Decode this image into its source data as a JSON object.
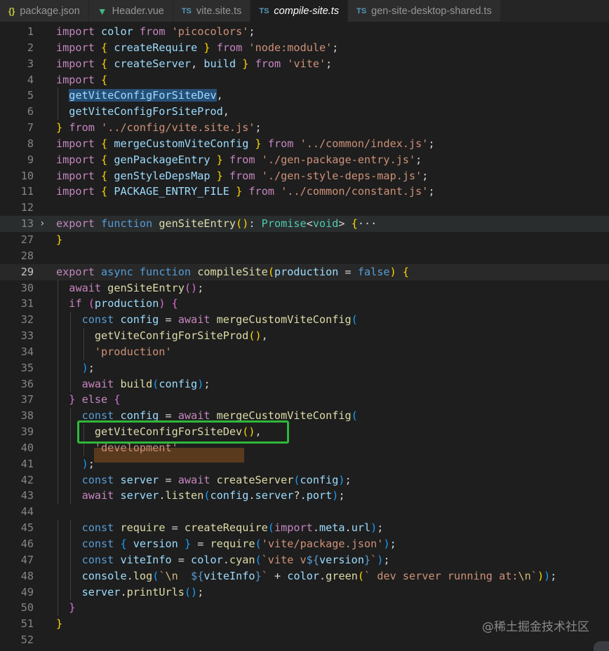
{
  "tabs": [
    {
      "label": "package.json",
      "icon": "{}",
      "icon_name": "json-icon",
      "icon_class": "json",
      "active": false
    },
    {
      "label": "Header.vue",
      "icon": "▼",
      "icon_name": "vue-icon",
      "icon_class": "vue",
      "active": false
    },
    {
      "label": "vite.site.ts",
      "icon": "TS",
      "icon_name": "typescript-icon",
      "icon_class": "ts",
      "active": false
    },
    {
      "label": "compile-site.ts",
      "icon": "TS",
      "icon_name": "typescript-icon",
      "icon_class": "ts",
      "active": true
    },
    {
      "label": "gen-site-desktop-shared.ts",
      "icon": "TS",
      "icon_name": "typescript-icon",
      "icon_class": "ts",
      "active": false
    }
  ],
  "colors": {
    "editor_bg": "#1e1e1e",
    "keyword": "#c586c0",
    "storage": "#569cd6",
    "string": "#ce9178",
    "function": "#dcdcaa",
    "variable": "#9cdcfe",
    "type": "#4ec9b0",
    "highlight_box": "#2fb83a"
  },
  "current_line": "29",
  "editor_lines": [
    {
      "n": "1",
      "tokens": [
        [
          "k",
          "import"
        ],
        [
          "p",
          " "
        ],
        [
          "v",
          "color"
        ],
        [
          "p",
          " "
        ],
        [
          "k",
          "from"
        ],
        [
          "p",
          " "
        ],
        [
          "s",
          "'picocolors'"
        ],
        [
          "p",
          ";"
        ]
      ]
    },
    {
      "n": "2",
      "tokens": [
        [
          "k",
          "import"
        ],
        [
          "p",
          " "
        ],
        [
          "b1",
          "{"
        ],
        [
          "p",
          " "
        ],
        [
          "v",
          "createRequire"
        ],
        [
          "p",
          " "
        ],
        [
          "b1",
          "}"
        ],
        [
          "p",
          " "
        ],
        [
          "k",
          "from"
        ],
        [
          "p",
          " "
        ],
        [
          "s",
          "'node:module'"
        ],
        [
          "p",
          ";"
        ]
      ]
    },
    {
      "n": "3",
      "tokens": [
        [
          "k",
          "import"
        ],
        [
          "p",
          " "
        ],
        [
          "b1",
          "{"
        ],
        [
          "p",
          " "
        ],
        [
          "v",
          "createServer"
        ],
        [
          "p",
          ", "
        ],
        [
          "v",
          "build"
        ],
        [
          "p",
          " "
        ],
        [
          "b1",
          "}"
        ],
        [
          "p",
          " "
        ],
        [
          "k",
          "from"
        ],
        [
          "p",
          " "
        ],
        [
          "s",
          "'vite'"
        ],
        [
          "p",
          ";"
        ]
      ]
    },
    {
      "n": "4",
      "tokens": [
        [
          "k",
          "import"
        ],
        [
          "p",
          " "
        ],
        [
          "b1",
          "{"
        ]
      ]
    },
    {
      "n": "5",
      "tokens": [
        [
          "p",
          "  "
        ],
        [
          "v sel",
          "getViteConfigForSiteDev"
        ],
        [
          "p",
          ","
        ]
      ]
    },
    {
      "n": "6",
      "tokens": [
        [
          "p",
          "  "
        ],
        [
          "v",
          "getViteConfigForSiteProd"
        ],
        [
          "p",
          ","
        ]
      ]
    },
    {
      "n": "7",
      "tokens": [
        [
          "b1",
          "}"
        ],
        [
          "p",
          " "
        ],
        [
          "k",
          "from"
        ],
        [
          "p",
          " "
        ],
        [
          "s",
          "'../config/vite.site.js'"
        ],
        [
          "p",
          ";"
        ]
      ]
    },
    {
      "n": "8",
      "tokens": [
        [
          "k",
          "import"
        ],
        [
          "p",
          " "
        ],
        [
          "b1",
          "{"
        ],
        [
          "p",
          " "
        ],
        [
          "v",
          "mergeCustomViteConfig"
        ],
        [
          "p",
          " "
        ],
        [
          "b1",
          "}"
        ],
        [
          "p",
          " "
        ],
        [
          "k",
          "from"
        ],
        [
          "p",
          " "
        ],
        [
          "s",
          "'../common/index.js'"
        ],
        [
          "p",
          ";"
        ]
      ]
    },
    {
      "n": "9",
      "tokens": [
        [
          "k",
          "import"
        ],
        [
          "p",
          " "
        ],
        [
          "b1",
          "{"
        ],
        [
          "p",
          " "
        ],
        [
          "v",
          "genPackageEntry"
        ],
        [
          "p",
          " "
        ],
        [
          "b1",
          "}"
        ],
        [
          "p",
          " "
        ],
        [
          "k",
          "from"
        ],
        [
          "p",
          " "
        ],
        [
          "s",
          "'./gen-package-entry.js'"
        ],
        [
          "p",
          ";"
        ]
      ]
    },
    {
      "n": "10",
      "tokens": [
        [
          "k",
          "import"
        ],
        [
          "p",
          " "
        ],
        [
          "b1",
          "{"
        ],
        [
          "p",
          " "
        ],
        [
          "v",
          "genStyleDepsMap"
        ],
        [
          "p",
          " "
        ],
        [
          "b1",
          "}"
        ],
        [
          "p",
          " "
        ],
        [
          "k",
          "from"
        ],
        [
          "p",
          " "
        ],
        [
          "s",
          "'./gen-style-deps-map.js'"
        ],
        [
          "p",
          ";"
        ]
      ]
    },
    {
      "n": "11",
      "tokens": [
        [
          "k",
          "import"
        ],
        [
          "p",
          " "
        ],
        [
          "b1",
          "{"
        ],
        [
          "p",
          " "
        ],
        [
          "v",
          "PACKAGE_ENTRY_FILE"
        ],
        [
          "p",
          " "
        ],
        [
          "b1",
          "}"
        ],
        [
          "p",
          " "
        ],
        [
          "k",
          "from"
        ],
        [
          "p",
          " "
        ],
        [
          "s",
          "'../common/constant.js'"
        ],
        [
          "p",
          ";"
        ]
      ]
    },
    {
      "n": "12",
      "tokens": []
    },
    {
      "n": "13",
      "fold": "›",
      "tokens": [
        [
          "k",
          "export"
        ],
        [
          "p",
          " "
        ],
        [
          "kb",
          "function"
        ],
        [
          "p",
          " "
        ],
        [
          "f",
          "genSiteEntry"
        ],
        [
          "b1",
          "()"
        ],
        [
          "p",
          ": "
        ],
        [
          "t",
          "Promise"
        ],
        [
          "p",
          "<"
        ],
        [
          "t",
          "void"
        ],
        [
          "p",
          "> "
        ],
        [
          "b1",
          "{"
        ],
        [
          "p",
          "···"
        ]
      ]
    },
    {
      "n": "27",
      "tokens": [
        [
          "b1",
          "}"
        ]
      ]
    },
    {
      "n": "28",
      "tokens": []
    },
    {
      "n": "29",
      "tokens": [
        [
          "k",
          "export"
        ],
        [
          "p",
          " "
        ],
        [
          "kb",
          "async"
        ],
        [
          "p",
          " "
        ],
        [
          "kb",
          "function"
        ],
        [
          "p",
          " "
        ],
        [
          "f",
          "compileSite"
        ],
        [
          "b1",
          "("
        ],
        [
          "v",
          "production"
        ],
        [
          "p",
          " = "
        ],
        [
          "kb",
          "false"
        ],
        [
          "b1",
          ")"
        ],
        [
          "p",
          " "
        ],
        [
          "b1",
          "{"
        ]
      ]
    },
    {
      "n": "30",
      "tokens": [
        [
          "p",
          "  "
        ],
        [
          "k",
          "await"
        ],
        [
          "p",
          " "
        ],
        [
          "f",
          "genSiteEntry"
        ],
        [
          "b2",
          "()"
        ],
        [
          "p",
          ";"
        ]
      ]
    },
    {
      "n": "31",
      "tokens": [
        [
          "p",
          "  "
        ],
        [
          "k",
          "if"
        ],
        [
          "p",
          " "
        ],
        [
          "b2",
          "("
        ],
        [
          "v",
          "production"
        ],
        [
          "b2",
          ")"
        ],
        [
          "p",
          " "
        ],
        [
          "b2",
          "{"
        ]
      ]
    },
    {
      "n": "32",
      "tokens": [
        [
          "p",
          "    "
        ],
        [
          "kb",
          "const"
        ],
        [
          "p",
          " "
        ],
        [
          "v",
          "config"
        ],
        [
          "p",
          " = "
        ],
        [
          "k",
          "await"
        ],
        [
          "p",
          " "
        ],
        [
          "f",
          "mergeCustomViteConfig"
        ],
        [
          "b3",
          "("
        ]
      ]
    },
    {
      "n": "33",
      "tokens": [
        [
          "p",
          "      "
        ],
        [
          "f",
          "getViteConfigForSiteProd"
        ],
        [
          "b1",
          "()"
        ],
        [
          "p",
          ","
        ]
      ]
    },
    {
      "n": "34",
      "tokens": [
        [
          "p",
          "      "
        ],
        [
          "s",
          "'production'"
        ]
      ]
    },
    {
      "n": "35",
      "tokens": [
        [
          "p",
          "    "
        ],
        [
          "b3",
          ")"
        ],
        [
          "p",
          ";"
        ]
      ]
    },
    {
      "n": "36",
      "tokens": [
        [
          "p",
          "    "
        ],
        [
          "k",
          "await"
        ],
        [
          "p",
          " "
        ],
        [
          "f",
          "build"
        ],
        [
          "b3",
          "("
        ],
        [
          "v",
          "config"
        ],
        [
          "b3",
          ")"
        ],
        [
          "p",
          ";"
        ]
      ]
    },
    {
      "n": "37",
      "tokens": [
        [
          "p",
          "  "
        ],
        [
          "b2",
          "}"
        ],
        [
          "p",
          " "
        ],
        [
          "k",
          "else"
        ],
        [
          "p",
          " "
        ],
        [
          "b2",
          "{"
        ]
      ]
    },
    {
      "n": "38",
      "tokens": [
        [
          "p",
          "    "
        ],
        [
          "kb",
          "const"
        ],
        [
          "p",
          " "
        ],
        [
          "v",
          "config"
        ],
        [
          "p",
          " = "
        ],
        [
          "k",
          "await"
        ],
        [
          "p",
          " "
        ],
        [
          "f",
          "mergeCustomViteConfig"
        ],
        [
          "b3",
          "("
        ]
      ]
    },
    {
      "n": "39",
      "tokens": [
        [
          "p",
          "      "
        ],
        [
          "f",
          "getViteConfigForSiteDev"
        ],
        [
          "b1",
          "()"
        ],
        [
          "p",
          ","
        ]
      ]
    },
    {
      "n": "40",
      "tokens": [
        [
          "p",
          "      "
        ],
        [
          "s",
          "'development'"
        ]
      ]
    },
    {
      "n": "41",
      "tokens": [
        [
          "p",
          "    "
        ],
        [
          "b3",
          ")"
        ],
        [
          "p",
          ";"
        ]
      ]
    },
    {
      "n": "42",
      "tokens": [
        [
          "p",
          "    "
        ],
        [
          "kb",
          "const"
        ],
        [
          "p",
          " "
        ],
        [
          "v",
          "server"
        ],
        [
          "p",
          " = "
        ],
        [
          "k",
          "await"
        ],
        [
          "p",
          " "
        ],
        [
          "f",
          "createServer"
        ],
        [
          "b3",
          "("
        ],
        [
          "v",
          "config"
        ],
        [
          "b3",
          ")"
        ],
        [
          "p",
          ";"
        ]
      ]
    },
    {
      "n": "43",
      "tokens": [
        [
          "p",
          "    "
        ],
        [
          "k",
          "await"
        ],
        [
          "p",
          " "
        ],
        [
          "v",
          "server"
        ],
        [
          "p",
          "."
        ],
        [
          "f",
          "listen"
        ],
        [
          "b3",
          "("
        ],
        [
          "v",
          "config"
        ],
        [
          "p",
          "."
        ],
        [
          "v",
          "server"
        ],
        [
          "p",
          "?."
        ],
        [
          "v",
          "port"
        ],
        [
          "b3",
          ")"
        ],
        [
          "p",
          ";"
        ]
      ]
    },
    {
      "n": "44",
      "tokens": []
    },
    {
      "n": "45",
      "tokens": [
        [
          "p",
          "    "
        ],
        [
          "kb",
          "const"
        ],
        [
          "p",
          " "
        ],
        [
          "f",
          "require"
        ],
        [
          "p",
          " = "
        ],
        [
          "f",
          "createRequire"
        ],
        [
          "b3",
          "("
        ],
        [
          "k",
          "import"
        ],
        [
          "p",
          "."
        ],
        [
          "v",
          "meta"
        ],
        [
          "p",
          "."
        ],
        [
          "v",
          "url"
        ],
        [
          "b3",
          ")"
        ],
        [
          "p",
          ";"
        ]
      ]
    },
    {
      "n": "46",
      "tokens": [
        [
          "p",
          "    "
        ],
        [
          "kb",
          "const"
        ],
        [
          "p",
          " "
        ],
        [
          "b3",
          "{"
        ],
        [
          "p",
          " "
        ],
        [
          "v",
          "version"
        ],
        [
          "p",
          " "
        ],
        [
          "b3",
          "}"
        ],
        [
          "p",
          " = "
        ],
        [
          "f",
          "require"
        ],
        [
          "b3",
          "("
        ],
        [
          "s",
          "'vite/package.json'"
        ],
        [
          "b3",
          ")"
        ],
        [
          "p",
          ";"
        ]
      ]
    },
    {
      "n": "47",
      "tokens": [
        [
          "p",
          "    "
        ],
        [
          "kb",
          "const"
        ],
        [
          "p",
          " "
        ],
        [
          "v",
          "viteInfo"
        ],
        [
          "p",
          " = "
        ],
        [
          "v",
          "color"
        ],
        [
          "p",
          "."
        ],
        [
          "f",
          "cyan"
        ],
        [
          "b3",
          "("
        ],
        [
          "s",
          "`vite v"
        ],
        [
          "kb",
          "${"
        ],
        [
          "v",
          "version"
        ],
        [
          "kb",
          "}"
        ],
        [
          "s",
          "`"
        ],
        [
          "b3",
          ")"
        ],
        [
          "p",
          ";"
        ]
      ]
    },
    {
      "n": "48",
      "tokens": [
        [
          "p",
          "    "
        ],
        [
          "v",
          "console"
        ],
        [
          "p",
          "."
        ],
        [
          "f",
          "log"
        ],
        [
          "b3",
          "("
        ],
        [
          "s",
          "`"
        ],
        [
          "e",
          "\\n"
        ],
        [
          "s",
          "  "
        ],
        [
          "kb",
          "${"
        ],
        [
          "v",
          "viteInfo"
        ],
        [
          "kb",
          "}"
        ],
        [
          "s",
          "`"
        ],
        [
          "p",
          " + "
        ],
        [
          "v",
          "color"
        ],
        [
          "p",
          "."
        ],
        [
          "f",
          "green"
        ],
        [
          "b1",
          "("
        ],
        [
          "s",
          "` dev server running at:"
        ],
        [
          "e",
          "\\n"
        ],
        [
          "s",
          "`"
        ],
        [
          "b1",
          ")"
        ],
        [
          "b3",
          ")"
        ],
        [
          "p",
          ";"
        ]
      ]
    },
    {
      "n": "49",
      "tokens": [
        [
          "p",
          "    "
        ],
        [
          "v",
          "server"
        ],
        [
          "p",
          "."
        ],
        [
          "f",
          "printUrls"
        ],
        [
          "b3",
          "()"
        ],
        [
          "p",
          ";"
        ]
      ]
    },
    {
      "n": "50",
      "tokens": [
        [
          "p",
          "  "
        ],
        [
          "b2",
          "}"
        ]
      ]
    },
    {
      "n": "51",
      "tokens": [
        [
          "b1",
          "}"
        ]
      ]
    },
    {
      "n": "52",
      "tokens": []
    }
  ],
  "watermark": "@稀土掘金技术社区"
}
